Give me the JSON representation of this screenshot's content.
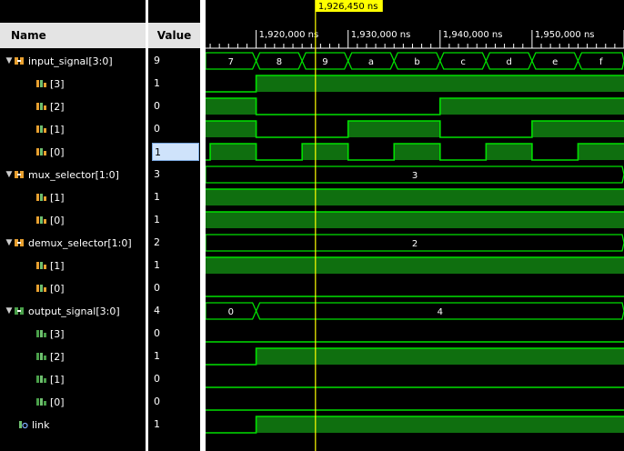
{
  "header": {
    "name_col": "Name",
    "value_col": "Value"
  },
  "cursor": {
    "label": "1,926,450 ns",
    "time": 1926450
  },
  "ruler": {
    "ticks": [
      {
        "label": "1,920,000 ns",
        "time": 1920000
      },
      {
        "label": "1,930,000 ns",
        "time": 1930000
      },
      {
        "label": "1,940,000 ns",
        "time": 1940000
      },
      {
        "label": "1,950,000 ns",
        "time": 1950000
      }
    ]
  },
  "time_range": {
    "start": 1914500,
    "end": 1960000
  },
  "colors": {
    "wave": "#00e000",
    "fill": "#0f6f0f",
    "cursor": "#ffff00",
    "bus_text": "#ffffff"
  },
  "signals": [
    {
      "label": "input_signal[3:0]",
      "value": "9",
      "icon": "bus-input-icon",
      "expand": true,
      "kind": "bus",
      "segments": [
        {
          "from": 1914500,
          "to": 1920000,
          "text": "7"
        },
        {
          "from": 1920000,
          "to": 1925000,
          "text": "8"
        },
        {
          "from": 1925000,
          "to": 1930000,
          "text": "9"
        },
        {
          "from": 1930000,
          "to": 1935000,
          "text": "a"
        },
        {
          "from": 1935000,
          "to": 1940000,
          "text": "b"
        },
        {
          "from": 1940000,
          "to": 1945000,
          "text": "c"
        },
        {
          "from": 1945000,
          "to": 1950000,
          "text": "d"
        },
        {
          "from": 1950000,
          "to": 1955000,
          "text": "e"
        },
        {
          "from": 1955000,
          "to": 1960000,
          "text": "f"
        }
      ]
    },
    {
      "label": "[3]",
      "value": "1",
      "icon": "bit-input-icon",
      "kind": "bit",
      "init": 0,
      "changes": [
        1920000
      ]
    },
    {
      "label": "[2]",
      "value": "0",
      "icon": "bit-input-icon",
      "kind": "bit",
      "init": 1,
      "changes": [
        1920000,
        1940000
      ]
    },
    {
      "label": "[1]",
      "value": "0",
      "icon": "bit-input-icon",
      "kind": "bit",
      "init": 1,
      "changes": [
        1920000,
        1930000,
        1940000,
        1950000
      ]
    },
    {
      "label": "[0]",
      "value": "1",
      "icon": "bit-input-icon",
      "kind": "bit",
      "selected": true,
      "init": 0,
      "changes": [
        1915000,
        1920000,
        1925000,
        1930000,
        1935000,
        1940000,
        1945000,
        1950000,
        1955000
      ]
    },
    {
      "label": "mux_selector[1:0]",
      "value": "3",
      "icon": "bus-input-icon",
      "expand": true,
      "kind": "bus",
      "segments": [
        {
          "from": 1914500,
          "to": 1960000,
          "text": "3"
        }
      ]
    },
    {
      "label": "[1]",
      "value": "1",
      "icon": "bit-input-icon",
      "kind": "bit",
      "init": 1,
      "changes": []
    },
    {
      "label": "[0]",
      "value": "1",
      "icon": "bit-input-icon",
      "kind": "bit",
      "init": 1,
      "changes": []
    },
    {
      "label": "demux_selector[1:0]",
      "value": "2",
      "icon": "bus-input-icon",
      "expand": true,
      "kind": "bus",
      "segments": [
        {
          "from": 1914500,
          "to": 1960000,
          "text": "2"
        }
      ]
    },
    {
      "label": "[1]",
      "value": "1",
      "icon": "bit-input-icon",
      "kind": "bit",
      "init": 1,
      "changes": []
    },
    {
      "label": "[0]",
      "value": "0",
      "icon": "bit-input-icon",
      "kind": "bit",
      "init": 0,
      "changes": []
    },
    {
      "label": "output_signal[3:0]",
      "value": "4",
      "icon": "bus-output-icon",
      "expand": true,
      "kind": "bus",
      "segments": [
        {
          "from": 1914500,
          "to": 1920000,
          "text": "0"
        },
        {
          "from": 1920000,
          "to": 1960000,
          "text": "4"
        }
      ]
    },
    {
      "label": "[3]",
      "value": "0",
      "icon": "bit-output-icon",
      "kind": "bit",
      "init": 0,
      "changes": []
    },
    {
      "label": "[2]",
      "value": "1",
      "icon": "bit-output-icon",
      "kind": "bit",
      "init": 0,
      "changes": [
        1920000
      ]
    },
    {
      "label": "[1]",
      "value": "0",
      "icon": "bit-output-icon",
      "kind": "bit",
      "init": 0,
      "changes": []
    },
    {
      "label": "[0]",
      "value": "0",
      "icon": "bit-output-icon",
      "kind": "bit",
      "init": 0,
      "changes": []
    },
    {
      "label": "link",
      "value": "1",
      "icon": "link-icon",
      "kind": "bit",
      "init": 0,
      "changes": [
        1920000
      ]
    }
  ]
}
